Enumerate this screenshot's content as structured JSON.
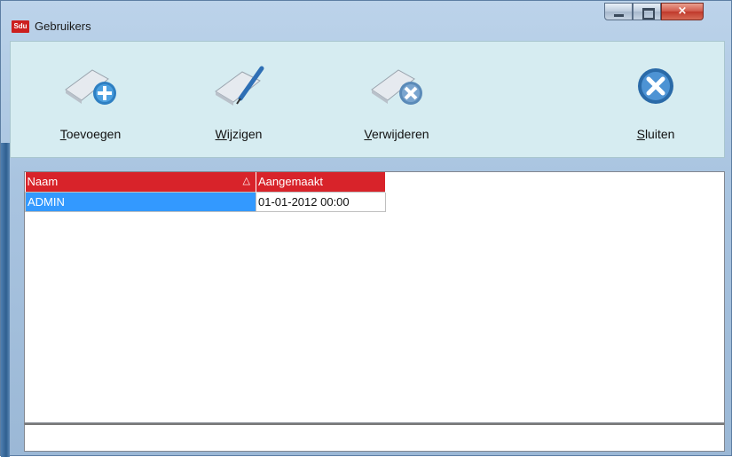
{
  "window": {
    "title": "Gebruikers",
    "app_icon_text": "Sdu",
    "controls": {
      "minimize": "minimize-icon",
      "maximize": "maximize-icon",
      "close": "×"
    }
  },
  "toolbar": {
    "add_label_first": "T",
    "add_label_rest": "oevoegen",
    "edit_label_first": "W",
    "edit_label_rest": "ijzigen",
    "delete_label_first": "V",
    "delete_label_rest": "erwijderen",
    "close_label_first": "S",
    "close_label_rest": "luiten"
  },
  "grid": {
    "columns": [
      "Naam",
      "Aangemaakt"
    ],
    "sort_indicator": "△",
    "rows": [
      {
        "naam": "ADMIN",
        "aangemaakt": "01-01-2012 00:00"
      }
    ]
  },
  "colors": {
    "header_bg": "#d8232a",
    "selection": "#3399ff",
    "toolbar_bg": "#d6ecf1"
  }
}
